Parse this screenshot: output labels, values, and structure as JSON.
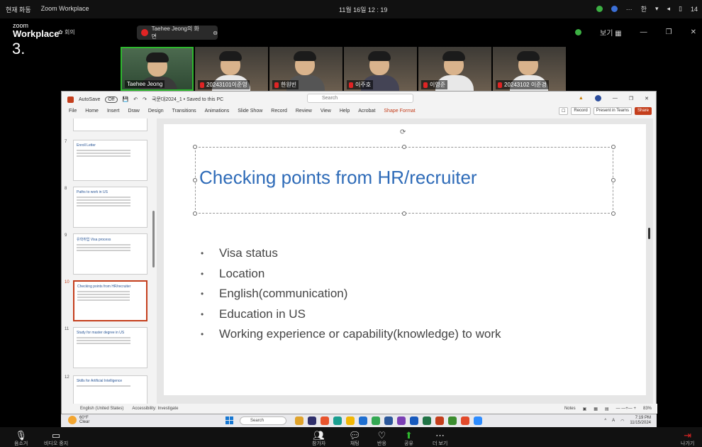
{
  "sysbar": {
    "left_items": [
      "현재 화동",
      "Zoom Workplace"
    ],
    "clock": "11월 16일 12 : 19",
    "right_items": [
      "···",
      "한",
      "14"
    ]
  },
  "header": {
    "brand_small": "zoom",
    "brand_big": "Workplace",
    "meeting_label": "회의",
    "share_label": "Taehee Jeong의 화면",
    "view_label": "보기",
    "page_digit": "3."
  },
  "participants": [
    {
      "name": "Taehee Jeong",
      "active": true
    },
    {
      "name": "20243101이준영",
      "active": false
    },
    {
      "name": "한원빈",
      "active": false
    },
    {
      "name": "이주호",
      "active": false
    },
    {
      "name": "이영준",
      "active": false
    },
    {
      "name": "20243102 이준경",
      "active": false
    }
  ],
  "ppt": {
    "autosave": "AutoSave",
    "autosave_state": "Off",
    "doc_title": "국문대2024_1 • Saved to this PC",
    "search_placeholder": "Search",
    "menu": [
      "File",
      "Home",
      "Insert",
      "Draw",
      "Design",
      "Transitions",
      "Animations",
      "Slide Show",
      "Record",
      "Review",
      "View",
      "Help",
      "Acrobat",
      "Shape Format"
    ],
    "actions": [
      "Record",
      "Present in Teams",
      "Share"
    ],
    "thumbnails": [
      {
        "num": "7",
        "title": "Enroll Letter"
      },
      {
        "num": "8",
        "title": "Paths to work in US"
      },
      {
        "num": "9",
        "title": "유학취업 Visa process"
      },
      {
        "num": "10",
        "title": "Checking points from HR/recruiter",
        "selected": true
      },
      {
        "num": "11",
        "title": "Study for master degree in US"
      },
      {
        "num": "12",
        "title": "Skills for Artificial Intelligence"
      }
    ],
    "slide": {
      "title": "Checking points from HR/recruiter",
      "bullets": [
        "Visa status",
        "Location",
        "English(communication)",
        "Education in US",
        "Working experience or capability(knowledge) to work"
      ]
    },
    "status": {
      "language": "English (United States)",
      "accessibility": "Accessibility: Investigate",
      "notes": "Notes",
      "zoom": "83%"
    }
  },
  "taskbar": {
    "weather_temp": "60°F",
    "weather_desc": "Clear",
    "search_label": "Search",
    "lang": "A",
    "time": "7:19 PM",
    "date": "11/15/2024"
  },
  "footer": {
    "mute": "음소거",
    "video": "비디오 중지",
    "participants": "참가자",
    "chat": "채팅",
    "react": "반응",
    "share": "공유",
    "more": "더 보기",
    "leave": "나가기"
  }
}
